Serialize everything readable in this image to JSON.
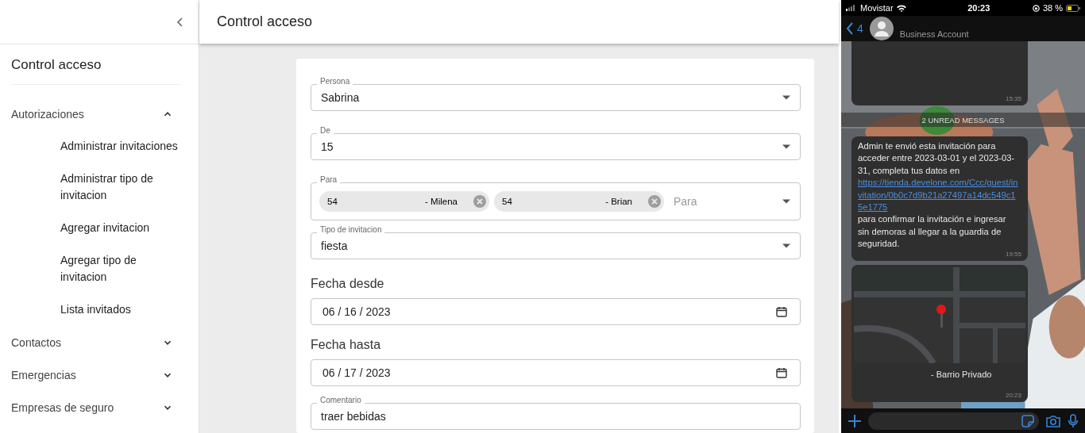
{
  "sidebar": {
    "title": "Control acceso",
    "items": [
      {
        "label": "Autorizaciones",
        "expanded": true,
        "children": [
          {
            "label": "Administrar invitaciones"
          },
          {
            "label": "Administrar tipo de invitacion"
          },
          {
            "label": "Agregar invitacion"
          },
          {
            "label": "Agregar tipo de invitacion"
          },
          {
            "label": "Lista invitados"
          }
        ]
      },
      {
        "label": "Contactos",
        "expanded": false
      },
      {
        "label": "Emergencias",
        "expanded": false
      },
      {
        "label": "Empresas de seguro",
        "expanded": false
      }
    ]
  },
  "header": {
    "title": "Control acceso"
  },
  "form": {
    "fields": [
      {
        "kind": "select",
        "label": "Persona",
        "value": "Sabrina"
      },
      {
        "kind": "select",
        "label": "De",
        "value": "15"
      },
      {
        "kind": "chips",
        "label": "Para",
        "placeholder": "Para",
        "chips": [
          {
            "number": "54",
            "name": "- Milena"
          },
          {
            "number": "54",
            "name": "- Brian"
          }
        ]
      },
      {
        "kind": "select",
        "label": "Tipo de invitacion",
        "value": "fiesta"
      },
      {
        "kind": "date",
        "label": "Fecha desde",
        "value": "06 / 16 / 2023"
      },
      {
        "kind": "date",
        "label": "Fecha hasta",
        "value": "06 / 17 / 2023"
      },
      {
        "kind": "text",
        "label": "Comentario",
        "value": "traer bebidas"
      }
    ]
  },
  "phone": {
    "carrier": "Movistar",
    "clock": "20:23",
    "battery": "38 %",
    "back_count": "4",
    "contact": "Business Account",
    "unread": "2 UNREAD MESSAGES",
    "messages": [
      {
        "kind": "blank",
        "time": "15:35"
      },
      {
        "kind": "text",
        "before": "Admin te envió esta invitación para acceder entre 2023-03-01 y el 2023-03-31, completa tus datos en ",
        "link": "https://tienda.develone.com/Ccc/guest/invitation/0b0c7d9b21a27497a14dc549c15e1775",
        "after": " para confirmar la invitación e ingresar sin demoras al llegar a la guardia de seguridad.",
        "time": "19:55"
      },
      {
        "kind": "location",
        "caption": "- Barrio Privado",
        "time": "20:23"
      }
    ]
  }
}
